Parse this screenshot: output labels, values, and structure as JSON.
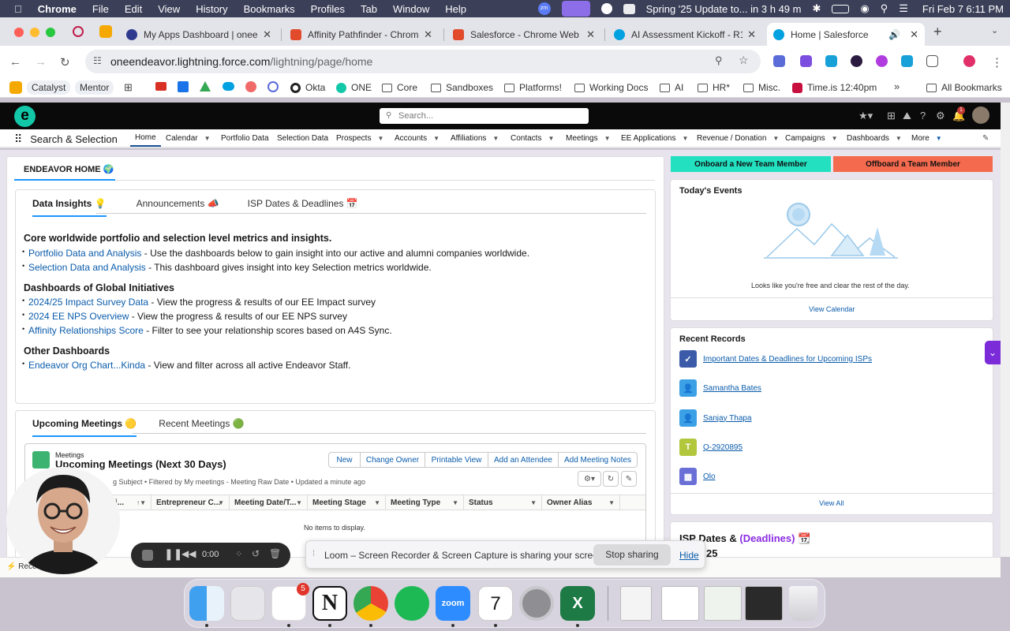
{
  "menubar": {
    "apple": "",
    "items": [
      "Chrome",
      "File",
      "Edit",
      "View",
      "History",
      "Bookmarks",
      "Profiles",
      "Tab",
      "Window",
      "Help"
    ],
    "event": "Spring '25 Update to... in 3 h 49 m",
    "datetime": "Fri Feb 7  6:11 PM"
  },
  "tabs": [
    {
      "title": "My Apps Dashboard | oneen",
      "color": "#2f3a8f"
    },
    {
      "title": "Affinity Pathfinder - Chrome",
      "color": "#e24a2c"
    },
    {
      "title": "Salesforce - Chrome Web St",
      "color": "#e24a2c"
    },
    {
      "title": "AI Assessment Kickoff - R1/",
      "color": "#00a1e0"
    },
    {
      "title": "Home | Salesforce",
      "color": "#00a1e0"
    }
  ],
  "toolbar": {
    "url_host": "oneendeavor.lightning.force.com",
    "url_path": "/lightning/page/home"
  },
  "bookmarks": [
    "Catalyst",
    "Mentor",
    "Okta",
    "ONE",
    "Core",
    "Sandboxes",
    "Platforms!",
    "Working Docs",
    "AI",
    "HR*",
    "Misc.",
    "Time.is 12:40pm",
    "All Bookmarks"
  ],
  "sf": {
    "search_placeholder": "Search...",
    "app_name": "Search & Selection",
    "nav": [
      "Home",
      "Calendar",
      "Portfolio Data",
      "Selection Data",
      "Prospects",
      "Accounts",
      "Affiliations",
      "Contacts",
      "Meetings",
      "EE Applications",
      "Revenue / Donation",
      "Campaigns",
      "Dashboards",
      "More"
    ],
    "notif_count": "1"
  },
  "home": {
    "title": "ENDEAVOR HOME 🌍",
    "tabs": [
      "Data Insights 💡",
      "Announcements 📣",
      "ISP Dates & Deadlines 📅"
    ],
    "h1": "Core worldwide portfolio and selection level metrics and insights.",
    "b1_link": "Portfolio Data and Analysis",
    "b1_text": " - Use the dashboards below to gain insight into our active and alumni companies worldwide.",
    "b2_link": "Selection Data and Analysis",
    "b2_text": " - This dashboard gives insight into key Selection metrics worldwide.",
    "h2": "Dashboards of Global Initiatives",
    "b3_link": "2024/25 Impact Survey Data",
    "b3_text": " - View the progress & results of our EE Impact survey",
    "b4_link": "2024 EE NPS Overview",
    "b4_text": " - View the progress & results of our EE NPS survey",
    "b5_link": "Affinity Relationships Score",
    "b5_text": " - Filter to see your relationship scores based on A4S Sync.",
    "h3": "Other Dashboards",
    "b6_link": "Endeavor Org Chart...Kinda",
    "b6_text": " - View and filter across all active Endeavor Staff."
  },
  "meetings": {
    "tabs": [
      "Upcoming Meetings 🟡",
      "Recent Meetings 🟢"
    ],
    "object": "Meetings",
    "title": "Upcoming Meetings (Next 30 Days)",
    "subtitle": "g Subject • Filtered by My meetings - Meeting Raw Date • Updated a minute ago",
    "buttons": [
      "New",
      "Change Owner",
      "Printable View",
      "Add an Attendee",
      "Add Meeting Notes"
    ],
    "columns": [
      "i...",
      "Entrepreneur C...",
      "Meeting Date/T...",
      "Meeting Stage",
      "Meeting Type",
      "Status",
      "Owner Alias"
    ],
    "empty": "No items to display."
  },
  "right": {
    "onboard": "Onboard a New Team Member",
    "offboard": "Offboard a Team Member",
    "events_title": "Today's Events",
    "events_empty": "Looks like you're free and clear the rest of the day.",
    "view_calendar": "View Calendar",
    "recent_title": "Recent Records",
    "records": [
      {
        "name": "Important Dates & Deadlines for Upcoming ISPs",
        "color": "#3b5ba9",
        "glyph": "✓"
      },
      {
        "name": "Samantha Bates",
        "color": "#3ba0e6",
        "glyph": "👤"
      },
      {
        "name": "Sanjay Thapa",
        "color": "#3ba0e6",
        "glyph": "👤"
      },
      {
        "name": "Q-2920895",
        "color": "#b2c73c",
        "glyph": "T"
      },
      {
        "name": "Olo",
        "color": "#6a6fd8",
        "glyph": "▦"
      }
    ],
    "view_all": "View All",
    "isp_title": "ISP Dates & ",
    "isp_deadlines": "(Deadlines)",
    "isp_year": "25"
  },
  "loom": {
    "text": "Loom – Screen Recorder & Screen Capture is sharing your screen.",
    "stop": "Stop sharing",
    "hide": "Hide"
  },
  "recorder": {
    "time": "0:00"
  },
  "footer_left": "Recen",
  "dock": {
    "slack_badge": "5",
    "cal_day": "7"
  }
}
